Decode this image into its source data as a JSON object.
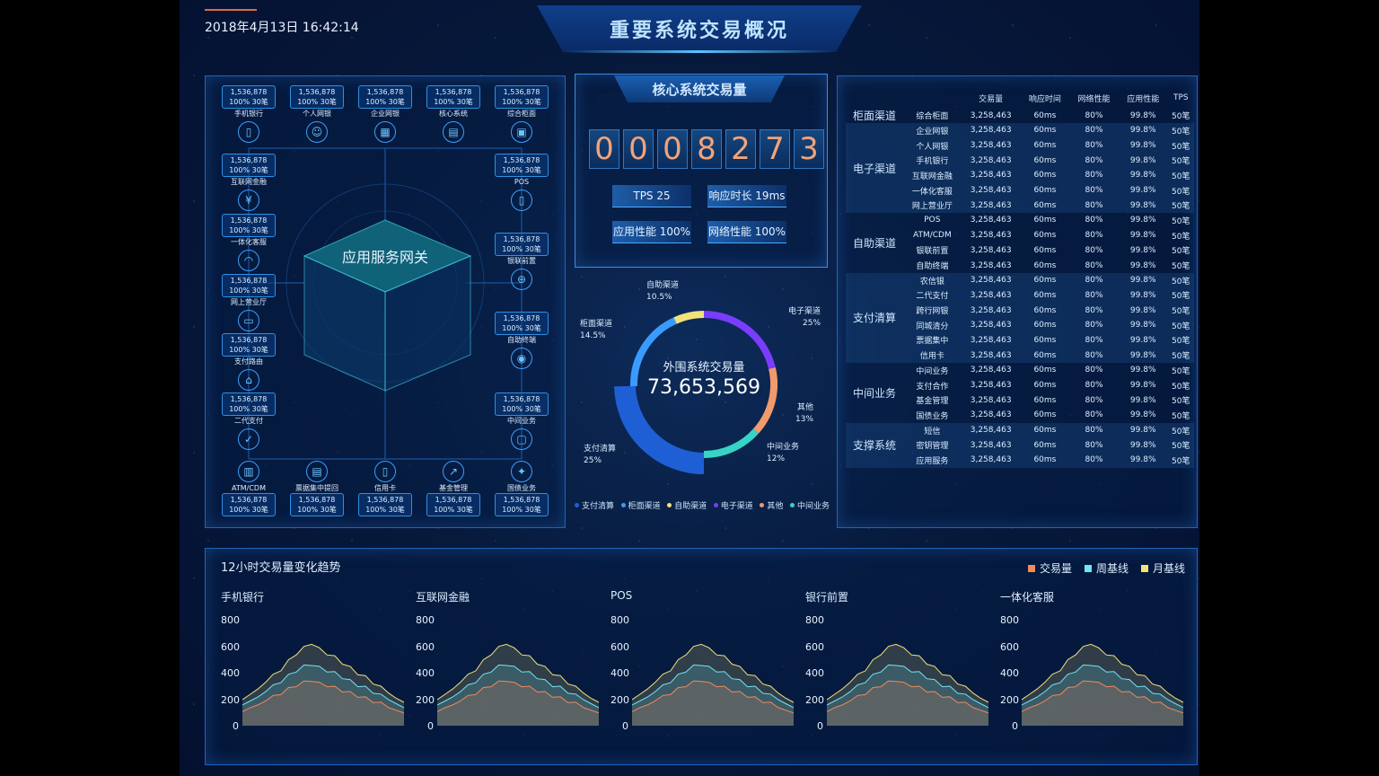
{
  "header": {
    "datetime": "2018年4月13日   16:42:14",
    "title": "重要系统交易概况"
  },
  "gateway": {
    "title": "应用服务网关",
    "top_nodes": [
      {
        "value": "1,536,878",
        "stat": "100% 30笔",
        "label": "手机银行",
        "icon": "phone-icon"
      },
      {
        "value": "1,536,878",
        "stat": "100% 30笔",
        "label": "个人网银",
        "icon": "person-icon"
      },
      {
        "value": "1,536,878",
        "stat": "100% 30笔",
        "label": "企业网银",
        "icon": "building-icon"
      },
      {
        "value": "1,536,878",
        "stat": "100% 30笔",
        "label": "核心系统",
        "icon": "document-icon"
      },
      {
        "value": "1,536,878",
        "stat": "100% 30笔",
        "label": "综合柜面",
        "icon": "grid-icon"
      }
    ],
    "left_nodes": [
      {
        "value": "1,536,878",
        "stat": "100% 30笔",
        "label": "互联网金融",
        "icon": "yen-icon"
      },
      {
        "value": "1,536,878",
        "stat": "100% 30笔",
        "label": "一体化客服",
        "icon": "headset-icon"
      },
      {
        "value": "1,536,878",
        "stat": "100% 30笔",
        "label": "网上营业厅",
        "icon": "monitor-icon"
      },
      {
        "value": "1,536,878",
        "stat": "100% 30笔",
        "label": "支付路由",
        "icon": "router-icon"
      },
      {
        "value": "1,536,878",
        "stat": "100% 30笔",
        "label": "二代支付",
        "icon": "check-icon"
      }
    ],
    "right_nodes": [
      {
        "value": "1,536,878",
        "stat": "100% 30笔",
        "label": "POS",
        "icon": "pos-icon"
      },
      {
        "value": "1,536,878",
        "stat": "100% 30笔",
        "label": "银联前置",
        "icon": "network-icon"
      },
      {
        "value": "1,536,878",
        "stat": "100% 30笔",
        "label": "自助终端",
        "icon": "terminal-icon"
      },
      {
        "value": "1,536,878",
        "stat": "100% 30笔",
        "label": "中间业务",
        "icon": "tray-icon"
      }
    ],
    "bottom_nodes": [
      {
        "value": "1,536,878",
        "stat": "100% 30笔",
        "label": "ATM/CDM",
        "icon": "atm-icon"
      },
      {
        "value": "1,536,878",
        "stat": "100% 30笔",
        "label": "票据集中提回",
        "icon": "ticket-icon"
      },
      {
        "value": "1,536,878",
        "stat": "100% 30笔",
        "label": "信用卡",
        "icon": "card-icon"
      },
      {
        "value": "1,536,878",
        "stat": "100% 30笔",
        "label": "基金管理",
        "icon": "chart-icon"
      },
      {
        "value": "1,536,878",
        "stat": "100% 30笔",
        "label": "国债业务",
        "icon": "star-icon"
      }
    ]
  },
  "core": {
    "title": "核心系统交易量",
    "digits": [
      "0",
      "0",
      "0",
      "8",
      "2",
      "7",
      "3"
    ],
    "kpis": {
      "tps": "TPS  25",
      "response": "响应时长 19ms",
      "app_perf": "应用性能 100%",
      "net_perf": "网络性能 100%"
    }
  },
  "donut": {
    "center_label": "外围系统交易量",
    "center_value": "73,653,569",
    "labels": [
      {
        "name": "自助渠道",
        "pct": "10.5%"
      },
      {
        "name": "电子渠道",
        "pct": "25%"
      },
      {
        "name": "柜面渠道",
        "pct": "14.5%"
      },
      {
        "name": "其他",
        "pct": "13%"
      },
      {
        "name": "支付清算",
        "pct": "25%"
      },
      {
        "name": "中间业务",
        "pct": "12%"
      }
    ],
    "legend": [
      {
        "name": "支付清算",
        "color": "#1f5fd6"
      },
      {
        "name": "柜面渠道",
        "color": "#3a9bff"
      },
      {
        "name": "自助渠道",
        "color": "#f2e27a"
      },
      {
        "name": "电子渠道",
        "color": "#7a3cff"
      },
      {
        "name": "其他",
        "color": "#f29a6a"
      },
      {
        "name": "中间业务",
        "color": "#36d3c6"
      }
    ]
  },
  "table": {
    "headers": [
      "交易量",
      "响应时间",
      "网络性能",
      "应用性能",
      "TPS"
    ],
    "groups": [
      {
        "name": "柜面渠道",
        "rows": [
          [
            "综合柜面",
            "3,258,463",
            "60ms",
            "80%",
            "99.8%",
            "50笔"
          ]
        ]
      },
      {
        "name": "电子渠道",
        "rows": [
          [
            "企业网银",
            "3,258,463",
            "60ms",
            "80%",
            "99.8%",
            "50笔"
          ],
          [
            "个人网银",
            "3,258,463",
            "60ms",
            "80%",
            "99.8%",
            "50笔"
          ],
          [
            "手机银行",
            "3,258,463",
            "60ms",
            "80%",
            "99.8%",
            "50笔"
          ],
          [
            "互联网金融",
            "3,258,463",
            "60ms",
            "80%",
            "99.8%",
            "50笔"
          ],
          [
            "一体化客服",
            "3,258,463",
            "60ms",
            "80%",
            "99.8%",
            "50笔"
          ],
          [
            "网上营业厅",
            "3,258,463",
            "60ms",
            "80%",
            "99.8%",
            "50笔"
          ]
        ]
      },
      {
        "name": "自助渠道",
        "rows": [
          [
            "POS",
            "3,258,463",
            "60ms",
            "80%",
            "99.8%",
            "50笔"
          ],
          [
            "ATM/CDM",
            "3,258,463",
            "60ms",
            "80%",
            "99.8%",
            "50笔"
          ],
          [
            "银联前置",
            "3,258,463",
            "60ms",
            "80%",
            "99.8%",
            "50笔"
          ],
          [
            "自助终端",
            "3,258,463",
            "60ms",
            "80%",
            "99.8%",
            "50笔"
          ]
        ]
      },
      {
        "name": "支付清算",
        "rows": [
          [
            "农信银",
            "3,258,463",
            "60ms",
            "80%",
            "99.8%",
            "50笔"
          ],
          [
            "二代支付",
            "3,258,463",
            "60ms",
            "80%",
            "99.8%",
            "50笔"
          ],
          [
            "跨行网银",
            "3,258,463",
            "60ms",
            "80%",
            "99.8%",
            "50笔"
          ],
          [
            "同城清分",
            "3,258,463",
            "60ms",
            "80%",
            "99.8%",
            "50笔"
          ],
          [
            "票据集中",
            "3,258,463",
            "60ms",
            "80%",
            "99.8%",
            "50笔"
          ],
          [
            "信用卡",
            "3,258,463",
            "60ms",
            "80%",
            "99.8%",
            "50笔"
          ]
        ]
      },
      {
        "name": "中间业务",
        "rows": [
          [
            "中间业务",
            "3,258,463",
            "60ms",
            "80%",
            "99.8%",
            "50笔"
          ],
          [
            "支付合作",
            "3,258,463",
            "60ms",
            "80%",
            "99.8%",
            "50笔"
          ],
          [
            "基金管理",
            "3,258,463",
            "60ms",
            "80%",
            "99.8%",
            "50笔"
          ],
          [
            "国债业务",
            "3,258,463",
            "60ms",
            "80%",
            "99.8%",
            "50笔"
          ]
        ]
      },
      {
        "name": "支撑系统",
        "rows": [
          [
            "短信",
            "3,258,463",
            "60ms",
            "80%",
            "99.8%",
            "50笔"
          ],
          [
            "密钥管理",
            "3,258,463",
            "60ms",
            "80%",
            "99.8%",
            "50笔"
          ],
          [
            "应用服务",
            "3,258,463",
            "60ms",
            "80%",
            "99.8%",
            "50笔"
          ]
        ]
      }
    ]
  },
  "trend": {
    "title": "12小时交易量变化趋势",
    "legend": [
      {
        "name": "交易量",
        "color": "#f28a5a"
      },
      {
        "name": "周基线",
        "color": "#6fe6f2"
      },
      {
        "name": "月基线",
        "color": "#f2e27a"
      }
    ]
  },
  "chart_data": {
    "type": "area",
    "ylim": [
      0,
      800
    ],
    "yticks": [
      "800",
      "600",
      "400",
      "200",
      "0"
    ],
    "charts": [
      {
        "title": "手机银行"
      },
      {
        "title": "互联网金融"
      },
      {
        "title": "POS"
      },
      {
        "title": "银行前置"
      },
      {
        "title": "一体化客服"
      }
    ],
    "series": [
      {
        "name": "交易量",
        "color": "#f28a5a",
        "values": [
          120,
          150,
          170,
          200,
          230,
          260,
          290,
          320,
          340,
          360,
          330,
          320,
          300,
          280,
          260,
          240,
          220,
          200,
          180,
          150,
          130,
          110
        ]
      },
      {
        "name": "周基线",
        "color": "#6fe6f2",
        "values": [
          170,
          200,
          230,
          270,
          310,
          350,
          390,
          430,
          460,
          480,
          450,
          430,
          410,
          380,
          350,
          320,
          300,
          270,
          240,
          210,
          180,
          150
        ]
      },
      {
        "name": "月基线",
        "color": "#f2e27a",
        "values": [
          210,
          250,
          290,
          340,
          390,
          440,
          500,
          560,
          600,
          640,
          590,
          560,
          530,
          490,
          450,
          410,
          380,
          340,
          300,
          260,
          220,
          190
        ]
      }
    ]
  }
}
